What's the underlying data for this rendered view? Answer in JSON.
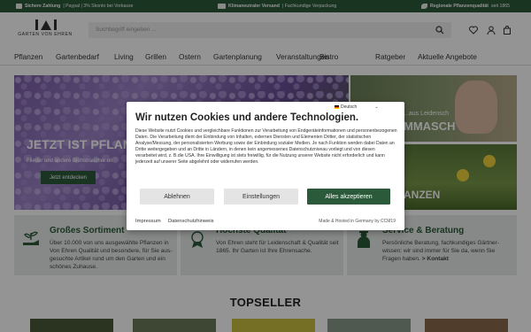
{
  "topbar": {
    "item1_bold": "Sichere Zahlung",
    "item1_rest": " | Paypal | 3% Skonto bei Vorkasse",
    "item2_bold": "Klimaneutraler Versand",
    "item2_rest": " | Fachkundige Verpackung",
    "item3_bold": "Regionale Pflanzenqualität",
    "item3_rest": " seit 1865"
  },
  "header": {
    "logo_text": "GARTEN VON EHREN",
    "search_placeholder": "Suchbegriff eingeben ...",
    "icons": [
      "search-icon",
      "heart-icon",
      "user-icon",
      "cart-icon"
    ]
  },
  "nav": {
    "items": [
      "Pflanzen",
      "Gartenbedarf",
      "Living",
      "Grillen",
      "Ostern",
      "Gartenplanung",
      "Veranstaltungen",
      "Bistro",
      "Ratgeber",
      "Aktuelle Angebote"
    ]
  },
  "hero": {
    "headline": "JETZT IST PFLANZ",
    "subline": "Flieder und andere Blühstraucher ori",
    "button": "Jetzt entdecken"
  },
  "promo1": {
    "line1": "...aus Leidensch",
    "line2": "MMASCH"
  },
  "promo2": {
    "line1": "ANZEN"
  },
  "usps": [
    {
      "title": "Großes Sortiment",
      "text": "Über 10.000 von uns ausgewählte Pflanzen in Von Ehren Qualität und besondere, für Sie aus-gesuchte Artikel rund um den Garten und ein schönes Zuhause.",
      "icon": "plant-hand-icon"
    },
    {
      "title": "Höchste Qualität",
      "text": "Von Ehren steht für Leidenschaft & Qualität seit 1865. Ihr Garten ist Ihre Ehrensache.",
      "icon": "quality-icon"
    },
    {
      "title": "Service & Beratung",
      "text": "Persönliche Beratung, fachkundiges Gärtner-wissen: wir sind immer für Sie da, wenn Sie Fragen haben.",
      "link": "> Kontakt",
      "icon": "gardener-icon"
    }
  ],
  "topseller": "TOPSELLER",
  "cookie": {
    "language": "Deutsch",
    "title": "Wir nutzen Cookies und andere Technologien.",
    "body": "Diese Website nutzt Cookies und vergleichbare Funktionen zur Verarbeitung von Endgeräteinformationen und personenbezogenen Daten. Die Verarbeitung dient der Einbindung von Inhalten, externen Diensten und Elementen Dritter, der statistischen Analyse/Messung, der personalisierten Werbung sowie der Einbindung sozialer Medien. Je nach Funktion werden dabei Daten an Dritte weitergegeben und an Dritte in Ländern, in denen kein angemessenes Datenschutzniveau vorliegt und von diesen verarbeitet wird, z. B.die USA. Ihre Einwilligung ist stets freiwillig, für die Nutzung unserer Website nicht erforderlich und kann jederzeit auf unserer Seite abgelehnt oder widerrufen werden.",
    "reject": "Ablehnen",
    "settings": "Einstellungen",
    "accept": "Alles akzeptieren",
    "imprint": "Impressum",
    "privacy": "Datenschutzhinweis",
    "made_by": "Made & Hosted in Germany by CCM19"
  },
  "colors": {
    "brand_green": "#2b5a3a",
    "usp_bg": "#e7ece8"
  }
}
